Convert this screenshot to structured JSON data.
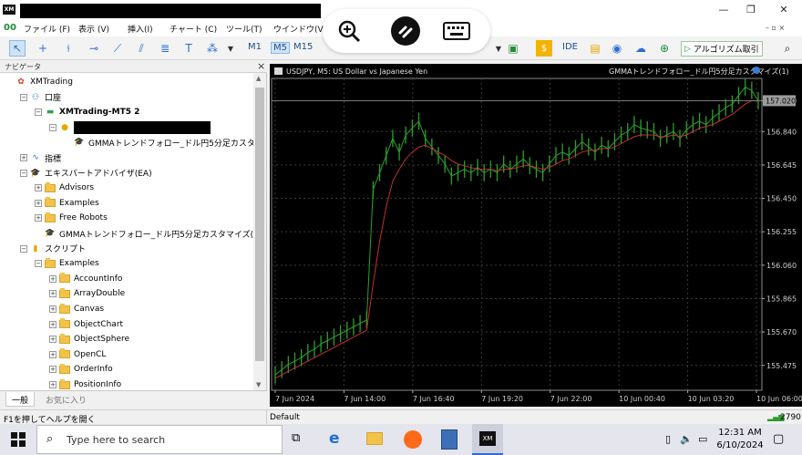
{
  "app": {
    "window_buttons": [
      "—",
      "❐",
      "✕"
    ],
    "menus": [
      "ファイル (F)",
      "表示 (V)",
      "挿入(I)",
      "チャート (C)",
      "ツール(T)",
      "ウインドウ(V"
    ]
  },
  "toolbar": {
    "timeframes": [
      "M1",
      "M5",
      "M15"
    ],
    "active_timeframe": "M5",
    "ide_label": "IDE",
    "algo_label": "アルゴリズム取引"
  },
  "navigator": {
    "title": "ナビゲータ",
    "close": "×",
    "items": [
      {
        "label": "XMTrading",
        "indent": 0,
        "icon": "xm-logo-icon",
        "expander": ""
      },
      {
        "label": "口座",
        "indent": 1,
        "icon": "accounts-icon",
        "expander": "−"
      },
      {
        "label": "XMTrading-MT5 2",
        "indent": 2,
        "icon": "server-icon",
        "expander": "−",
        "bold": true
      },
      {
        "label": "",
        "indent": 3,
        "icon": "account-user-icon",
        "expander": "−",
        "redacted": true
      },
      {
        "label": "GMMAトレンドフォロー_ドル円5分足カスタマイズ",
        "indent": 4,
        "icon": "ea-cap-icon",
        "expander": ""
      },
      {
        "label": "指標",
        "indent": 1,
        "icon": "indicator-icon",
        "expander": "+"
      },
      {
        "label": "エキスパートアドバイザ(EA)",
        "indent": 1,
        "icon": "ea-cap-icon",
        "expander": "−"
      },
      {
        "label": "Advisors",
        "indent": 2,
        "icon": "folder-icon",
        "expander": "+"
      },
      {
        "label": "Examples",
        "indent": 2,
        "icon": "folder-icon",
        "expander": "+"
      },
      {
        "label": "Free Robots",
        "indent": 2,
        "icon": "folder-icon",
        "expander": "+"
      },
      {
        "label": "GMMAトレンドフォロー_ドル円5分足カスタマイズ(1)",
        "indent": 2,
        "icon": "ea-cap-icon",
        "expander": ""
      },
      {
        "label": "スクリプト",
        "indent": 1,
        "icon": "script-icon",
        "expander": "−"
      },
      {
        "label": "Examples",
        "indent": 2,
        "icon": "folder-icon",
        "expander": "−"
      },
      {
        "label": "AccountInfo",
        "indent": 3,
        "icon": "folder-icon",
        "expander": "+"
      },
      {
        "label": "ArrayDouble",
        "indent": 3,
        "icon": "folder-icon",
        "expander": "+"
      },
      {
        "label": "Canvas",
        "indent": 3,
        "icon": "folder-icon",
        "expander": "+"
      },
      {
        "label": "ObjectChart",
        "indent": 3,
        "icon": "folder-icon",
        "expander": "+"
      },
      {
        "label": "ObjectSphere",
        "indent": 3,
        "icon": "folder-icon",
        "expander": "+"
      },
      {
        "label": "OpenCL",
        "indent": 3,
        "icon": "folder-icon",
        "expander": "+"
      },
      {
        "label": "OrderInfo",
        "indent": 3,
        "icon": "folder-icon",
        "expander": "+"
      },
      {
        "label": "PositionInfo",
        "indent": 3,
        "icon": "folder-icon",
        "expander": "+"
      }
    ],
    "tabs": [
      "一般",
      "お気に入り"
    ]
  },
  "chart_data": {
    "type": "line",
    "symbol_label": "USDJPY, M5:  US Dollar vs Japanese Yen",
    "ea_label": "GMMAトレンドフォロー_ドル円5分足カスタマイズ(1)",
    "current_price": "157.020",
    "y_ticks": [
      157.02,
      156.84,
      156.645,
      156.45,
      156.255,
      156.06,
      155.865,
      155.67,
      155.475
    ],
    "y_tick_labels": [
      "157.020",
      "156.840",
      "156.645",
      "156.450",
      "156.255",
      "156.060",
      "155.865",
      "155.670",
      "155.475"
    ],
    "ylim": [
      155.33,
      157.15
    ],
    "x_ticks": [
      "7 Jun 2024",
      "7 Jun 14:00",
      "7 Jun 16:40",
      "7 Jun 19:20",
      "7 Jun 22:00",
      "10 Jun 00:40",
      "10 Jun 03:20",
      "10 Jun 06:00"
    ],
    "series": [
      {
        "values": [
          155.42,
          155.45,
          155.48,
          155.5,
          155.52,
          155.55,
          155.57,
          155.6,
          155.62,
          155.64,
          155.66,
          155.68,
          155.7,
          155.72,
          155.74,
          156.5,
          156.6,
          156.7,
          156.8,
          156.72,
          156.82,
          156.86,
          156.9,
          156.8,
          156.75,
          156.7,
          156.65,
          156.58,
          156.6,
          156.62,
          156.6,
          156.63,
          156.6,
          156.62,
          156.6,
          156.65,
          156.62,
          156.65,
          156.68,
          156.64,
          156.62,
          156.6,
          156.65,
          156.7,
          156.72,
          156.7,
          156.74,
          156.78,
          156.75,
          156.72,
          156.76,
          156.74,
          156.78,
          156.82,
          156.84,
          156.88,
          156.86,
          156.85,
          156.84,
          156.8,
          156.82,
          156.84,
          156.8,
          156.85,
          156.88,
          156.9,
          156.88,
          156.92,
          156.95,
          156.98,
          157.0,
          157.05,
          157.1,
          157.08,
          157.02
        ],
        "color": "#2ba12b"
      },
      {
        "values": [
          155.4,
          155.42,
          155.44,
          155.46,
          155.48,
          155.5,
          155.52,
          155.54,
          155.56,
          155.58,
          155.6,
          155.62,
          155.64,
          155.66,
          155.68,
          155.95,
          156.2,
          156.4,
          156.55,
          156.62,
          156.68,
          156.72,
          156.75,
          156.76,
          156.74,
          156.72,
          156.7,
          156.67,
          156.65,
          156.64,
          156.63,
          156.62,
          156.62,
          156.62,
          156.61,
          156.62,
          156.62,
          156.63,
          156.64,
          156.64,
          156.63,
          156.62,
          156.63,
          156.65,
          156.67,
          156.68,
          156.7,
          156.72,
          156.73,
          156.73,
          156.74,
          156.74,
          156.75,
          156.77,
          156.79,
          156.81,
          156.82,
          156.82,
          156.82,
          156.81,
          156.81,
          156.82,
          156.81,
          156.82,
          156.84,
          156.86,
          156.87,
          156.88,
          156.9,
          156.92,
          156.94,
          156.97,
          157.0,
          157.02,
          157.02
        ],
        "color": "#c0302a"
      }
    ]
  },
  "status": {
    "help_text": "F1を押してヘルプを開く",
    "profile": "Default",
    "connection": "2790"
  },
  "taskbar": {
    "search_placeholder": "Type here to search",
    "time": "12:31 AM",
    "date": "6/10/2024"
  }
}
